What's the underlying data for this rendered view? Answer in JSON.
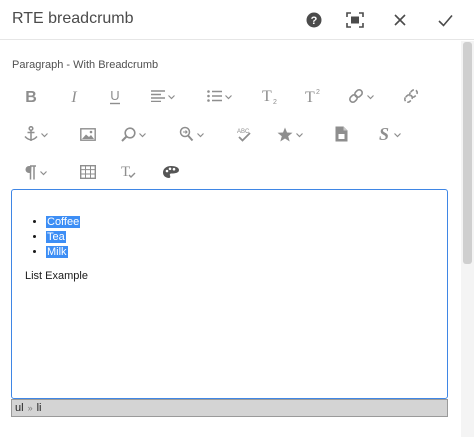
{
  "dialog": {
    "title": "RTE breadcrumb"
  },
  "field": {
    "label": "Paragraph - With Breadcrumb"
  },
  "editor": {
    "list_items": [
      "Coffee",
      "Tea",
      "Milk"
    ],
    "paragraph": "List Example"
  },
  "breadcrumb": {
    "items": [
      "ul",
      "li"
    ],
    "separator": "»"
  },
  "icons": {
    "help": "help-icon",
    "fullscreen": "fullscreen-icon",
    "close": "close-icon",
    "done": "checkmark-icon",
    "bold": "bold-icon",
    "italic": "italic-icon",
    "underline": "underline-icon",
    "justify": "justify-icon",
    "lists": "list-icon",
    "subscript": "subscript-icon",
    "superscript": "superscript-icon",
    "link": "link-icon",
    "unlink": "unlink-icon",
    "anchor": "anchor-icon",
    "image": "image-icon",
    "find": "find-icon",
    "replace": "find-replace-icon",
    "spellcheck": "spellcheck-icon",
    "special_chars": "star-icon",
    "paste": "paste-icon",
    "styles": "styles-icon",
    "paragraph": "paragraph-icon",
    "table": "table-icon",
    "source": "source-edit-icon",
    "color": "palette-icon"
  },
  "colors": {
    "accent": "#3f86e5",
    "selection": "#3d8ef5",
    "toolbar_icon": "#8e8e8e"
  }
}
